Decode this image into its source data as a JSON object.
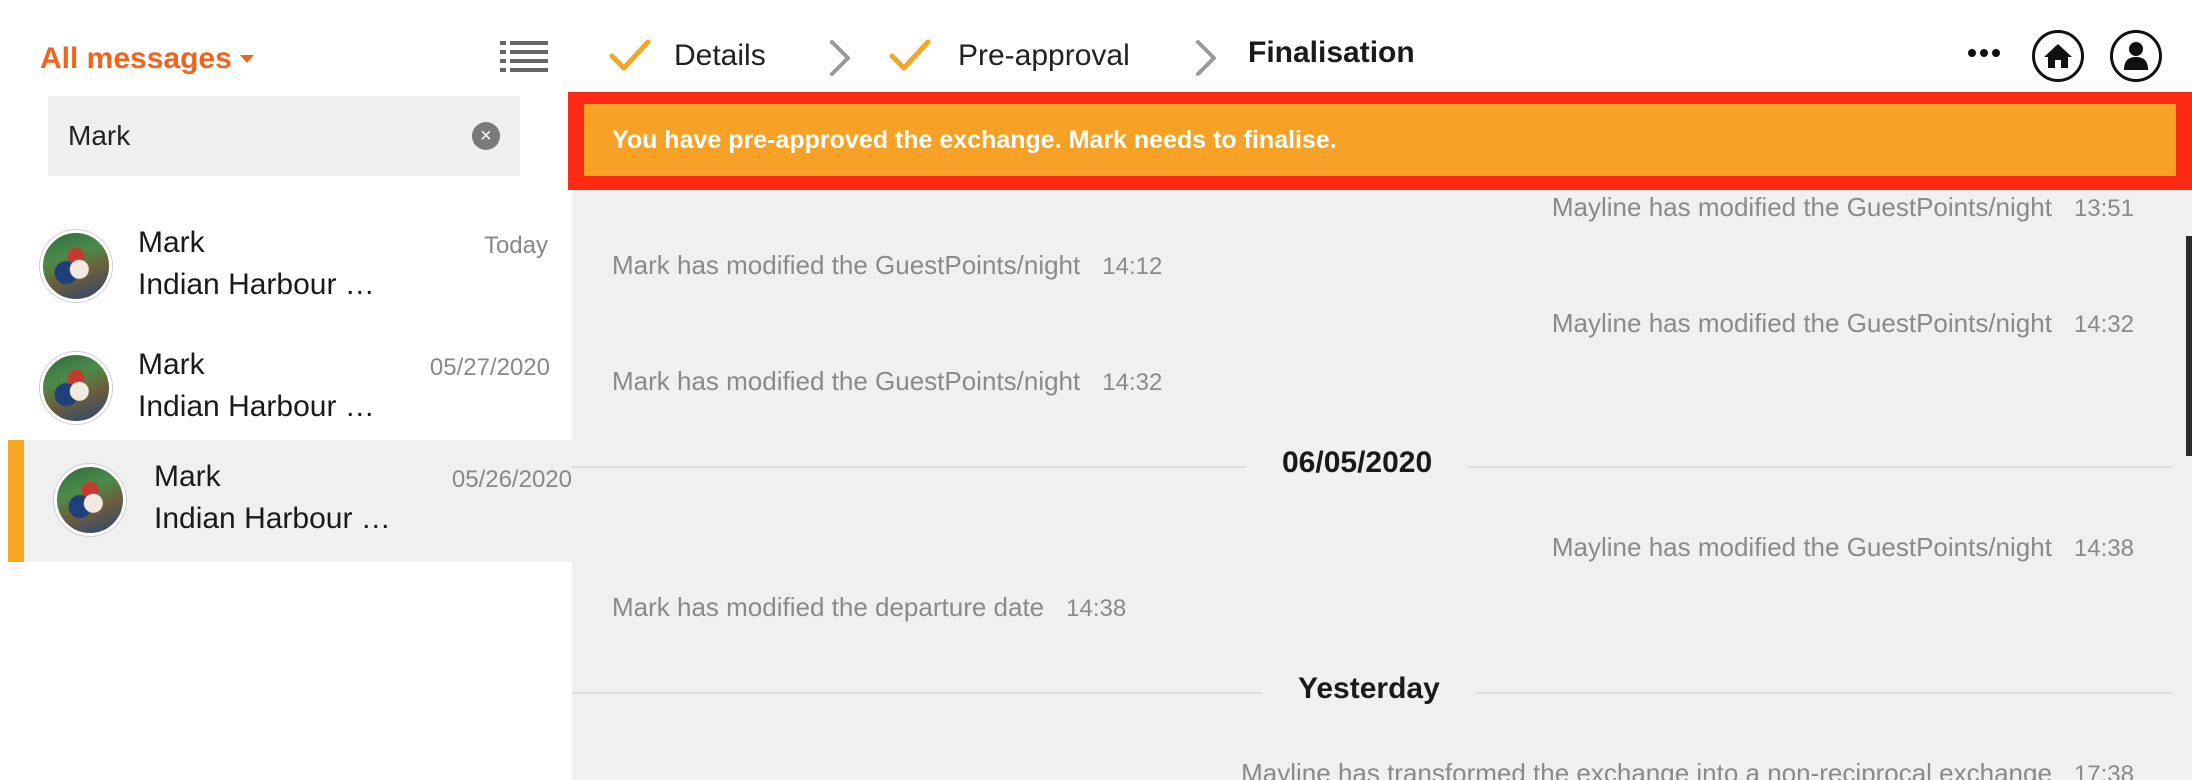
{
  "sidebar": {
    "title": "All messages",
    "search": {
      "value": "Mark",
      "placeholder": ""
    },
    "conversations": [
      {
        "name": "Mark",
        "date": "Today",
        "subtitle": "Indian Harbour Beach"
      },
      {
        "name": "Mark",
        "date": "05/27/2020",
        "subtitle": "Indian Harbour Beach"
      },
      {
        "name": "Mark",
        "date": "05/26/2020",
        "subtitle": "Indian Harbour Beach"
      }
    ]
  },
  "steps": [
    {
      "label": "Details",
      "state": "done"
    },
    {
      "label": "Pre-approval",
      "state": "done"
    },
    {
      "label": "Finalisation",
      "state": "current"
    }
  ],
  "topbar": {
    "more_icon": "ellipsis-icon",
    "home_icon": "home-icon",
    "profile_icon": "user-icon"
  },
  "banner": {
    "text": "You have pre-approved the exchange. Mark needs to finalise."
  },
  "messages": [
    {
      "text": "Mayline has modified the GuestPoints/night",
      "time": "13:51",
      "side": "right"
    },
    {
      "text": "Mark has modified the GuestPoints/night",
      "time": "14:12",
      "side": "left"
    },
    {
      "text": "Mayline has modified the GuestPoints/night",
      "time": "14:32",
      "side": "right"
    },
    {
      "text": "Mark has modified the GuestPoints/night",
      "time": "14:32",
      "side": "left"
    },
    {
      "day": "06/05/2020"
    },
    {
      "text": "Mayline has modified the GuestPoints/night",
      "time": "14:38",
      "side": "right"
    },
    {
      "text": "Mark has modified the departure date",
      "time": "14:38",
      "side": "left"
    },
    {
      "day": "Yesterday"
    },
    {
      "text": "Mayline has transformed the exchange into a non-reciprocal exchange",
      "time": "17:38",
      "side": "right"
    }
  ],
  "colors": {
    "accent": "#f5a623",
    "brand_orange": "#f0641e",
    "banner": "#f7a226",
    "banner_border": "#ff2a14"
  }
}
